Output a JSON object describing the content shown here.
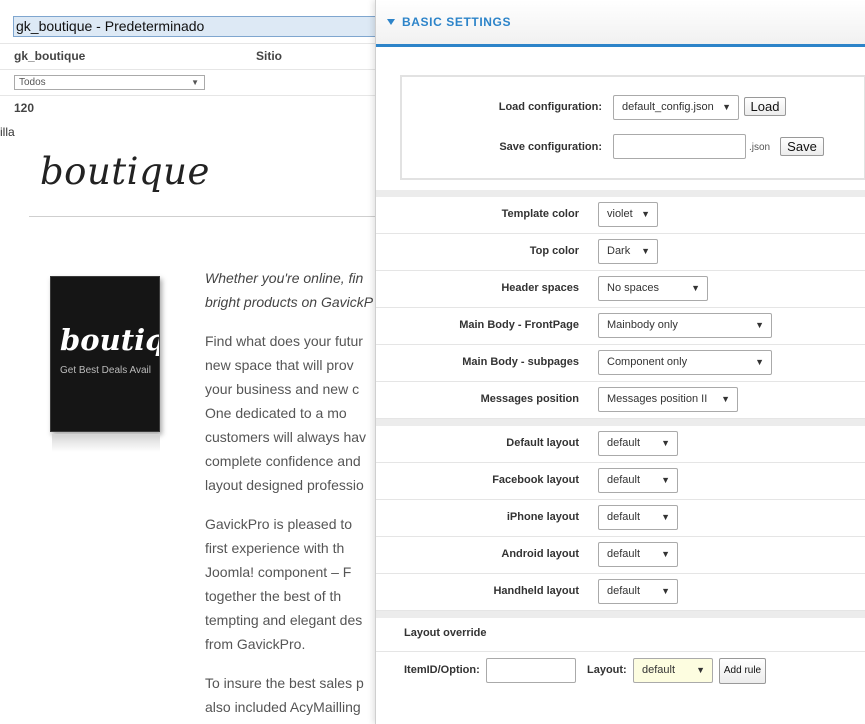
{
  "admin": {
    "template_title": "gk_boutique - Predeterminado",
    "template_name": "gk_boutique",
    "site_label": "Sitio",
    "filter_value": "Todos",
    "count": "120",
    "cut_text": "illa"
  },
  "preview": {
    "logo": "boutique",
    "book_title": "boutique",
    "book_subtitle": "Get Best Deals Avail",
    "intro_lines": [
      "Whether you're online, fin",
      "bright products on GavickP"
    ],
    "para1_lines": [
      "Find what does your futur",
      "new space that will prov",
      "your business and new c",
      "One dedicated to a mo",
      "customers will always hav",
      "complete confidence and",
      "layout designed professio"
    ],
    "para2_lines": [
      "GavickPro is pleased to",
      "first experience with th",
      "Joomla! component – F",
      "together the best of th",
      "tempting and elegant des",
      "from GavickPro."
    ],
    "para3_lines": [
      "To insure the best sales p",
      "also included AcyMailling"
    ]
  },
  "panel": {
    "header_title": "BASIC SETTINGS",
    "load_config_label": "Load configuration:",
    "load_config_value": "default_config.json",
    "load_button": "Load",
    "save_config_label": "Save configuration:",
    "save_suffix": ".json",
    "save_button": "Save",
    "settings": [
      {
        "label": "Template color",
        "value": "violet"
      },
      {
        "label": "Top color",
        "value": "Dark"
      },
      {
        "label": "Header spaces",
        "value": "No spaces"
      },
      {
        "label": "Main Body - FrontPage",
        "value": "Mainbody only"
      },
      {
        "label": "Main Body - subpages",
        "value": "Component only"
      },
      {
        "label": "Messages position",
        "value": "Messages position II"
      }
    ],
    "layouts": [
      {
        "label": "Default layout",
        "value": "default"
      },
      {
        "label": "Facebook layout",
        "value": "default"
      },
      {
        "label": "iPhone layout",
        "value": "default"
      },
      {
        "label": "Android layout",
        "value": "default"
      },
      {
        "label": "Handheld layout",
        "value": "default"
      }
    ],
    "layout_override": {
      "title": "Layout override",
      "itemid_label": "ItemID/Option:",
      "layout_label": "Layout:",
      "layout_value": "default",
      "add_rule_button": "Add rule"
    }
  },
  "colors": {
    "accent": "#2d84c9",
    "highlight_select": "#fdfde0"
  }
}
